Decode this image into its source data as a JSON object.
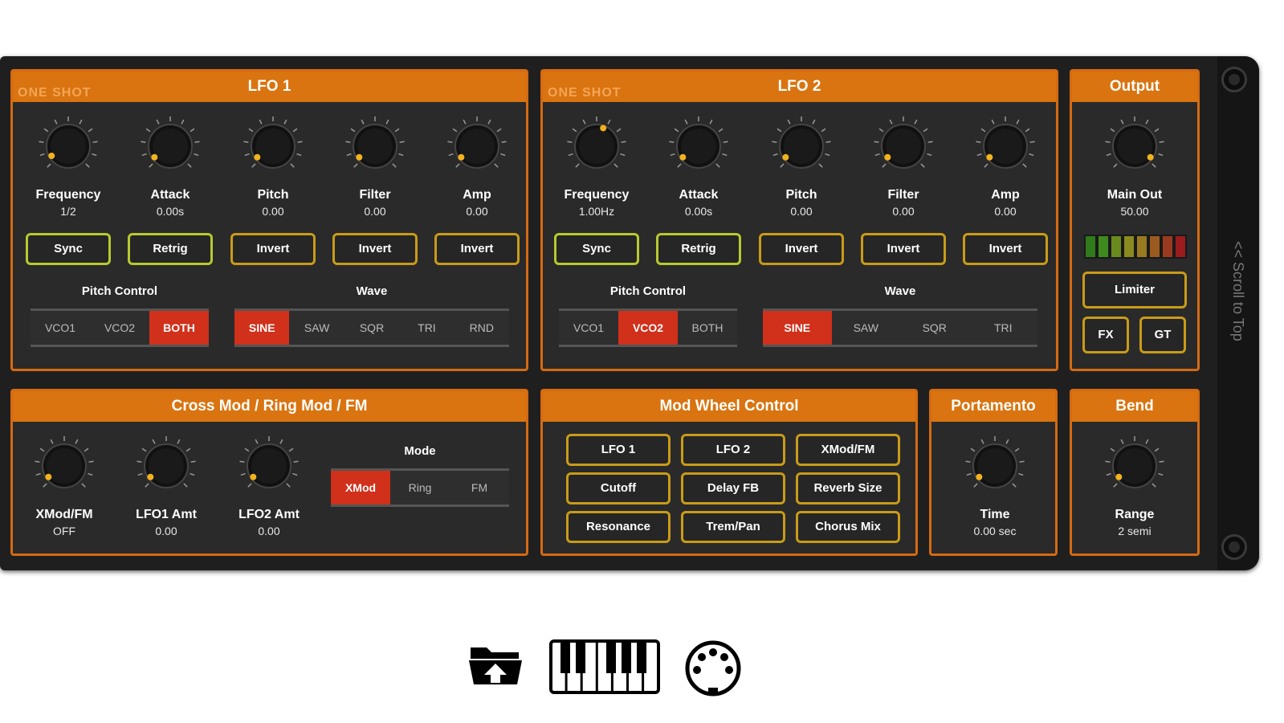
{
  "lfo1": {
    "title": "LFO 1",
    "logo": "ONE SHOT",
    "knobs": [
      {
        "label": "Frequency",
        "value": "1/2"
      },
      {
        "label": "Attack",
        "value": "0.00s"
      },
      {
        "label": "Pitch",
        "value": "0.00"
      },
      {
        "label": "Filter",
        "value": "0.00"
      },
      {
        "label": "Amp",
        "value": "0.00"
      }
    ],
    "buttons": [
      "Sync",
      "Retrig",
      "Invert",
      "Invert",
      "Invert"
    ],
    "pitch_control": {
      "title": "Pitch Control",
      "options": [
        "VCO1",
        "VCO2",
        "BOTH"
      ],
      "selected": "BOTH"
    },
    "wave": {
      "title": "Wave",
      "options": [
        "SINE",
        "SAW",
        "SQR",
        "TRI",
        "RND"
      ],
      "selected": "SINE"
    }
  },
  "lfo2": {
    "title": "LFO 2",
    "logo": "ONE SHOT",
    "knobs": [
      {
        "label": "Frequency",
        "value": "1.00Hz"
      },
      {
        "label": "Attack",
        "value": "0.00s"
      },
      {
        "label": "Pitch",
        "value": "0.00"
      },
      {
        "label": "Filter",
        "value": "0.00"
      },
      {
        "label": "Amp",
        "value": "0.00"
      }
    ],
    "buttons": [
      "Sync",
      "Retrig",
      "Invert",
      "Invert",
      "Invert"
    ],
    "pitch_control": {
      "title": "Pitch Control",
      "options": [
        "VCO1",
        "VCO2",
        "BOTH"
      ],
      "selected": "VCO2"
    },
    "wave": {
      "title": "Wave",
      "options": [
        "SINE",
        "SAW",
        "SQR",
        "TRI"
      ],
      "selected": "SINE"
    }
  },
  "output": {
    "title": "Output",
    "knob": {
      "label": "Main Out",
      "value": "50.00"
    },
    "meter_colors": [
      "#2f7a1b",
      "#3f8a1f",
      "#6a8a20",
      "#8a8a20",
      "#9a7a20",
      "#9a5a20",
      "#9a3a20",
      "#9a1c1c"
    ],
    "limiter": "Limiter",
    "fx": "FX",
    "gt": "GT"
  },
  "crossmod": {
    "title": "Cross Mod / Ring Mod / FM",
    "knobs": [
      {
        "label": "XMod/FM",
        "value": "OFF"
      },
      {
        "label": "LFO1 Amt",
        "value": "0.00"
      },
      {
        "label": "LFO2 Amt",
        "value": "0.00"
      }
    ],
    "mode": {
      "title": "Mode",
      "options": [
        "XMod",
        "Ring",
        "FM"
      ],
      "selected": "XMod"
    }
  },
  "modwheel": {
    "title": "Mod Wheel Control",
    "buttons": [
      "LFO 1",
      "LFO 2",
      "XMod/FM",
      "Cutoff",
      "Delay FB",
      "Reverb Size",
      "Resonance",
      "Trem/Pan",
      "Chorus Mix"
    ]
  },
  "portamento": {
    "title": "Portamento",
    "knob": {
      "label": "Time",
      "value": "0.00 sec"
    }
  },
  "bend": {
    "title": "Bend",
    "knob": {
      "label": "Range",
      "value": "2 semi"
    }
  },
  "sidebar": {
    "scroll_label": "<< Scroll to Top"
  },
  "dock": {
    "folder": "folder-icon",
    "keyboard": "piano-keyboard-icon",
    "midi": "midi-port-icon"
  },
  "colors": {
    "accent": "#d97410",
    "active": "#d1301b",
    "button_border": "#c99b18",
    "button_green": "#b8c930"
  }
}
